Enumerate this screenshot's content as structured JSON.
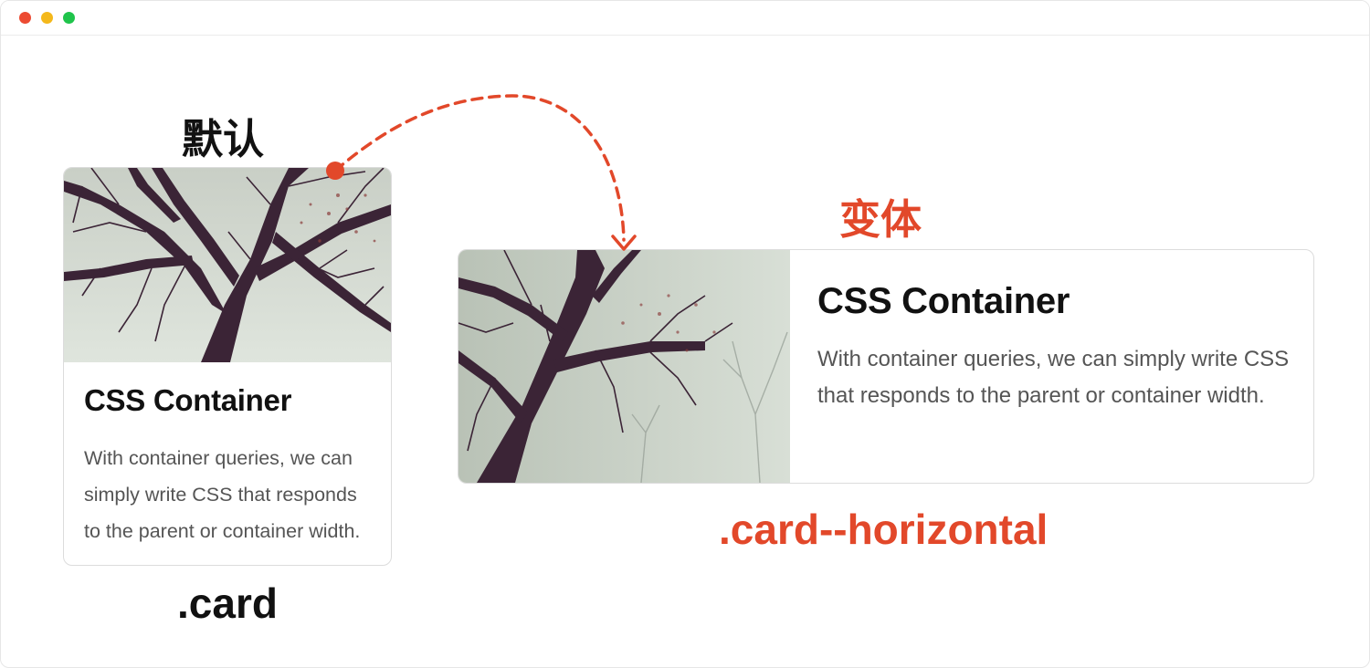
{
  "window": {
    "controls": [
      {
        "name": "close",
        "color": "#ec4b32"
      },
      {
        "name": "minimize",
        "color": "#f4b81b"
      },
      {
        "name": "maximize",
        "color": "#1fc44b"
      }
    ]
  },
  "labels": {
    "default": "默认",
    "variant": "变体",
    "card_class": ".card",
    "horizontal_class": ".card--horizontal"
  },
  "colors": {
    "accent": "#e2482a",
    "text_dark": "#111111",
    "text_muted": "#555555"
  },
  "card": {
    "title": "CSS Container",
    "description": "With container queries, we can simply write CSS that responds to the parent or container width.",
    "image": "misty-tree-photo"
  },
  "card_horizontal": {
    "title": "CSS Container",
    "description": "With container queries, we can simply write CSS that responds to the parent or container width.",
    "image": "misty-tree-photo"
  }
}
